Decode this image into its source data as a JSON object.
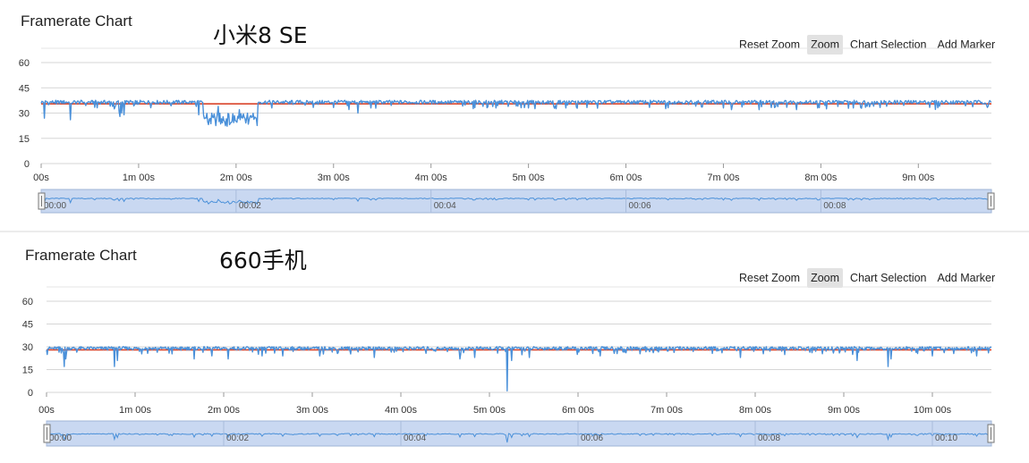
{
  "toolbar": {
    "reset_zoom": "Reset Zoom",
    "zoom": "Zoom",
    "chart_selection": "Chart Selection",
    "add_marker": "Add Marker"
  },
  "colors": {
    "series_line": "#4a90d9",
    "target_line": "#d9452b",
    "grid": "#d6d6d6",
    "navigator_fill": "#c9d8f1",
    "navigator_line": "#4a90d9"
  },
  "chart_data": [
    {
      "type": "line",
      "title": "Framerate Chart",
      "device": "小米8 SE",
      "y_ticks": [
        0,
        15,
        30,
        45,
        60
      ],
      "ylim": [
        0,
        60
      ],
      "x_ticks": [
        "00s",
        "1m 00s",
        "2m 00s",
        "3m 00s",
        "4m 00s",
        "5m 00s",
        "6m 00s",
        "7m 00s",
        "8m 00s",
        "9m 00s"
      ],
      "x_tick_seconds": [
        0,
        60,
        120,
        180,
        240,
        300,
        360,
        420,
        480,
        540
      ],
      "xlim_seconds": [
        0,
        585
      ],
      "reference_fps": 35.5,
      "baseline_fps": 36.5,
      "dips": [
        {
          "t": 2,
          "fps": 27
        },
        {
          "t": 18,
          "fps": 26
        },
        {
          "t": 48,
          "fps": 31
        },
        {
          "t": 51,
          "fps": 29
        },
        {
          "t": 48.5,
          "fps": 28
        },
        {
          "t": 49.5,
          "fps": 30
        },
        {
          "t": 97,
          "fps": 29
        },
        {
          "t": 109,
          "fps": 34
        },
        {
          "t": 122,
          "fps": 32
        },
        {
          "t": 142,
          "fps": 33
        },
        {
          "t": 195,
          "fps": 30
        },
        {
          "t": 203,
          "fps": 33
        },
        {
          "t": 280,
          "fps": 33
        },
        {
          "t": 300,
          "fps": 33
        },
        {
          "t": 420,
          "fps": 33
        },
        {
          "t": 425,
          "fps": 32
        },
        {
          "t": 442,
          "fps": 32
        },
        {
          "t": 465,
          "fps": 32
        },
        {
          "t": 478,
          "fps": 33
        },
        {
          "t": 500,
          "fps": 33
        }
      ],
      "low_segment": {
        "start": 100,
        "end": 133,
        "min_fps": 20,
        "max_fps": 30
      },
      "navigator_ticks": [
        "00:00",
        "00:02",
        "00:04",
        "00:06",
        "00:08"
      ],
      "navigator_tick_seconds": [
        0,
        120,
        240,
        360,
        480
      ]
    },
    {
      "type": "line",
      "title": "Framerate Chart",
      "device": "660手机",
      "y_ticks": [
        0,
        15,
        30,
        45,
        60
      ],
      "ylim": [
        0,
        60
      ],
      "x_ticks": [
        "00s",
        "1m 00s",
        "2m 00s",
        "3m 00s",
        "4m 00s",
        "5m 00s",
        "6m 00s",
        "7m 00s",
        "8m 00s",
        "9m 00s",
        "10m 00s"
      ],
      "x_tick_seconds": [
        0,
        60,
        120,
        180,
        240,
        300,
        360,
        420,
        480,
        540,
        600
      ],
      "xlim_seconds": [
        0,
        640
      ],
      "reference_fps": 28,
      "baseline_fps": 29,
      "dips": [
        {
          "t": 12,
          "fps": 17
        },
        {
          "t": 13,
          "fps": 22
        },
        {
          "t": 46,
          "fps": 17
        },
        {
          "t": 48,
          "fps": 21
        },
        {
          "t": 100,
          "fps": 22
        },
        {
          "t": 112,
          "fps": 24
        },
        {
          "t": 123,
          "fps": 22
        },
        {
          "t": 146,
          "fps": 24
        },
        {
          "t": 160,
          "fps": 24
        },
        {
          "t": 185,
          "fps": 24
        },
        {
          "t": 222,
          "fps": 23
        },
        {
          "t": 280,
          "fps": 22
        },
        {
          "t": 290,
          "fps": 23
        },
        {
          "t": 312,
          "fps": 1
        },
        {
          "t": 315,
          "fps": 21
        },
        {
          "t": 327,
          "fps": 23
        },
        {
          "t": 375,
          "fps": 24
        },
        {
          "t": 470,
          "fps": 23
        },
        {
          "t": 549,
          "fps": 21
        },
        {
          "t": 570,
          "fps": 17
        },
        {
          "t": 572,
          "fps": 22
        },
        {
          "t": 600,
          "fps": 24
        },
        {
          "t": 630,
          "fps": 24
        },
        {
          "t": 638,
          "fps": 26
        }
      ],
      "navigator_ticks": [
        "00:00",
        "00:02",
        "00:04",
        "00:06",
        "00:08",
        "00:10"
      ],
      "navigator_tick_seconds": [
        0,
        120,
        240,
        360,
        480,
        600
      ]
    }
  ]
}
